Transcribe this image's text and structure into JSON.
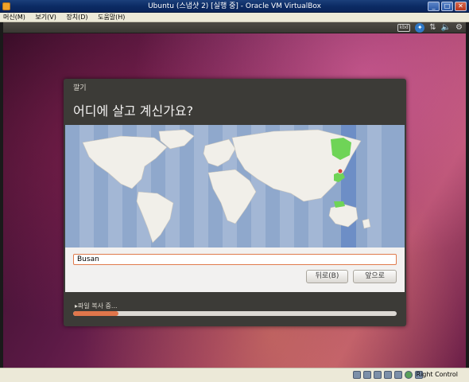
{
  "window": {
    "title": "Ubuntu (스냅샷 2) [실행 중] - Oracle VM VirtualBox",
    "min_label": "_",
    "max_label": "□",
    "close_label": "✕"
  },
  "menu": {
    "items": [
      "머신(M)",
      "보기(V)",
      "장치(D)",
      "도움말(H)"
    ]
  },
  "ubuntu_panel": {
    "tray_icons": [
      "keyboard-icon",
      "accessibility-icon",
      "network-icon",
      "volume-icon",
      "gear-icon"
    ],
    "keyboard_text": "kbd"
  },
  "installer": {
    "window_title": "깔기",
    "heading": "어디에 살고 계신가요?",
    "city_value": "Busan",
    "back_button": "뒤로(B)",
    "forward_button": "앞으로",
    "progress_label": "▸파일 복사 중...",
    "progress_fraction": 0.14,
    "colors": {
      "ocean": "#8fa8cc",
      "land": "#f1efe9",
      "timezone_band": "#6d8ec6",
      "selected_region": "#6fd457",
      "pin": "#d0473c",
      "accent": "#e0764b"
    }
  },
  "statusbar": {
    "host_key": "Right Control"
  }
}
